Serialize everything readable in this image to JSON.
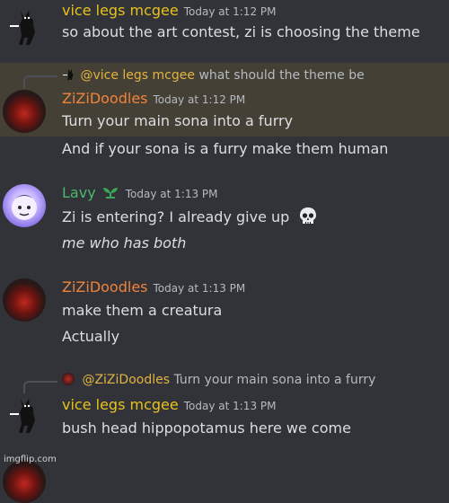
{
  "colors": {
    "vice_name": "#e8c21d",
    "zizi_name": "#f0833a",
    "lavy_name": "#4cb86a",
    "highlight_bg": "#444035"
  },
  "messages": [
    {
      "author": "vice legs mcgee",
      "time": "Today at 1:12 PM",
      "lines": [
        "so about the art contest, zi is choosing the theme"
      ]
    },
    {
      "reply_to": {
        "mention": "@vice legs mcgee",
        "text": "what should the theme be"
      },
      "author": "ZiZiDoodles",
      "time": "Today at 1:12 PM",
      "lines": [
        "Turn your main sona into a furry",
        "And if your sona is a furry make them human"
      ]
    },
    {
      "author": "Lavy",
      "time": "Today at 1:13 PM",
      "badge_icon": "leaf-badge-icon",
      "lines": [
        "Zi is entering? I already give up",
        "me who has both"
      ],
      "emoji_icon": "skull-emoji-icon"
    },
    {
      "author": "ZiZiDoodles",
      "time": "Today at 1:13 PM",
      "lines": [
        "make them a creatura",
        "Actually"
      ]
    },
    {
      "reply_to": {
        "mention": "@ZiZiDoodles",
        "text": "Turn your main sona into a furry"
      },
      "author": "vice legs mcgee",
      "time": "Today at 1:13 PM",
      "lines": [
        "bush head hippopotamus here we come"
      ]
    }
  ],
  "watermark": "imgflip.com"
}
